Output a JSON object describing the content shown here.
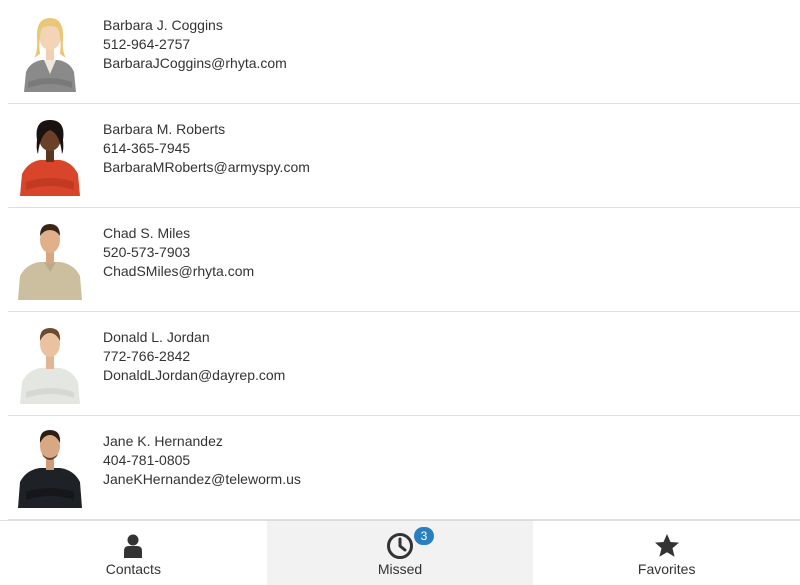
{
  "contacts": [
    {
      "name": "Barbara J. Coggins",
      "phone": "512-964-2757",
      "email": "BarbaraJCoggins@rhyta.com"
    },
    {
      "name": "Barbara M. Roberts",
      "phone": "614-365-7945",
      "email": "BarbaraMRoberts@armyspy.com"
    },
    {
      "name": "Chad S. Miles",
      "phone": "520-573-7903",
      "email": "ChadSMiles@rhyta.com"
    },
    {
      "name": "Donald L. Jordan",
      "phone": "772-766-2842",
      "email": "DonaldLJordan@dayrep.com"
    },
    {
      "name": "Jane K. Hernandez",
      "phone": "404-781-0805",
      "email": "JaneKHernandez@teleworm.us"
    }
  ],
  "tabs": [
    {
      "label": "Contacts",
      "icon": "user-icon",
      "active": false
    },
    {
      "label": "Missed",
      "icon": "clock-icon",
      "active": true,
      "badge": "3"
    },
    {
      "label": "Favorites",
      "icon": "star-icon",
      "active": false
    }
  ],
  "colors": {
    "badge": "#2a7fc1",
    "divider": "#dddddd",
    "active_tab_bg": "#f2f2f2",
    "text": "#333333"
  }
}
